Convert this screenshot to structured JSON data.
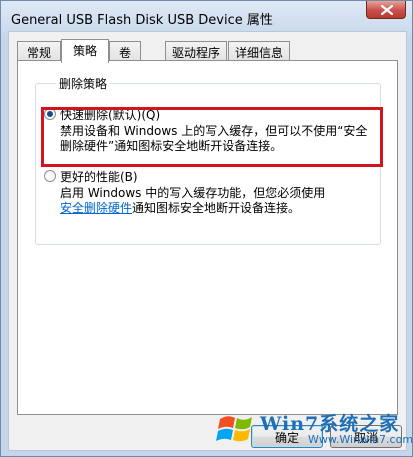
{
  "window": {
    "title": "General USB Flash Disk USB Device 属性"
  },
  "tabs": [
    {
      "label": "常规",
      "active": false
    },
    {
      "label": "策略",
      "active": true
    },
    {
      "label": "卷",
      "active": false
    },
    {
      "label": "驱动程序",
      "active": false
    },
    {
      "label": "详细信息",
      "active": false
    }
  ],
  "policy": {
    "group_label": "删除策略",
    "quick_removal": {
      "label": "快速删除(默认)(Q)",
      "selected": true,
      "description_line1": "禁用设备和 Windows 上的写入缓存，但可以不使用“安全",
      "description_line2": "删除硬件”通知图标安全地断开设备连接。"
    },
    "better_performance": {
      "label": "更好的性能(B)",
      "selected": false,
      "description_line1": "启用 Windows 中的写入缓存功能，但您必须使用",
      "description_link": "安全删除硬件",
      "description_line2_rest": "通知图标安全地断开设备连接。"
    }
  },
  "buttons": {
    "ok": "确定",
    "cancel": "取消"
  },
  "watermark": {
    "brand": "Win7系统之家",
    "url": "Www.Winwin7.com"
  },
  "colors": {
    "highlight_border": "#d0161c",
    "link": "#0066cc",
    "close_button": "#c75050"
  }
}
